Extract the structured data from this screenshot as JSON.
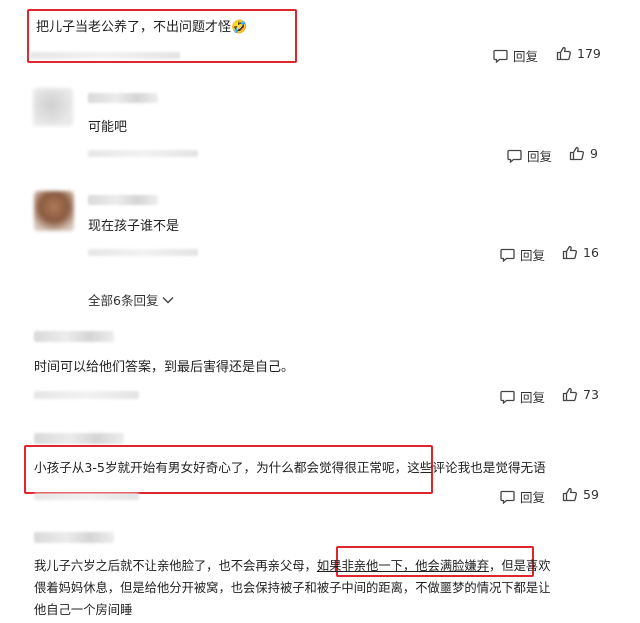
{
  "comments": [
    {
      "text": "把儿子当老公养了，不出问题才怪🤣",
      "reply_label": "回复",
      "likes": "179"
    },
    {
      "text": "可能吧",
      "reply_label": "回复",
      "likes": "9"
    },
    {
      "text": "现在孩子谁不是",
      "reply_label": "回复",
      "likes": "16"
    },
    {
      "text": "时间可以给他们答案，到最后害得还是自己。",
      "reply_label": "回复",
      "likes": "73"
    },
    {
      "text": "小孩子从3-5岁就开始有男女好奇心了，为什么都会觉得很正常呢，这些评论我也是觉得无语",
      "reply_label": "回复",
      "likes": "59"
    },
    {
      "text_line1_a": "我儿子六岁之后就不让亲他脸了，也不会再亲父母，",
      "text_line1_highlight": "如果非亲他一下，他会满脸嫌弃",
      "text_line1_b": "，但是喜欢",
      "text_line2": "偎着妈妈休息，但是给他分开被窝，也会保持被子和被子中间的距离，不做噩梦的情况下都是让",
      "text_line3": "他自己一个房间睡"
    }
  ],
  "expand_replies_label": "全部6条回复",
  "accent_color": "#e0262d"
}
